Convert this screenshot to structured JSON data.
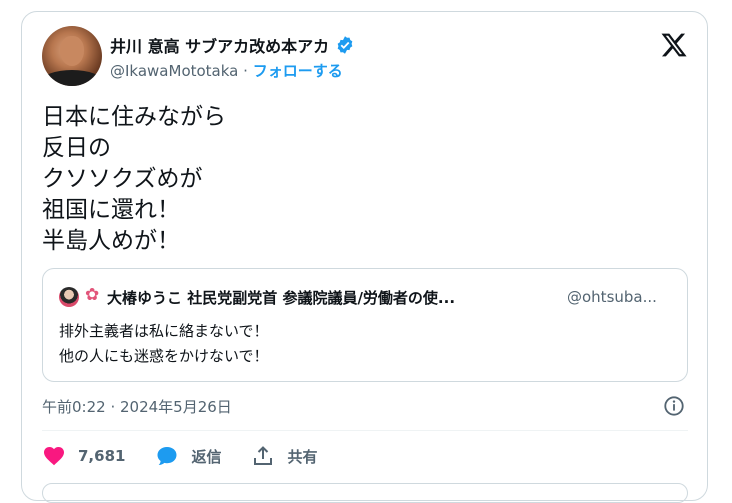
{
  "tweet": {
    "display_name": "井川 意高 サブアカ改め本アカ",
    "handle": "@IkawaMototaka",
    "separator": "·",
    "follow_label": "フォローする",
    "lines": [
      "日本に住みながら",
      "反日の",
      "クソソクズめが",
      "祖国に還れ！",
      "半島人めが！"
    ],
    "timestamp": "午前0:22 · 2024年5月26日"
  },
  "quote": {
    "display_name": "大椿ゆうこ 社民党副党首 参議院議員/労働者の使...",
    "handle": "@ohtsuba...",
    "lines": [
      "排外主義者は私に絡まないで！",
      "他の人にも迷惑をかけないで！"
    ]
  },
  "actions": {
    "like_count": "7,681",
    "reply_label": "返信",
    "share_label": "共有"
  },
  "colors": {
    "accent": "#1d9bf0",
    "like": "#f91880",
    "muted": "#536471"
  },
  "icons": [
    "avatar",
    "verified-badge-icon",
    "x-logo-icon",
    "flower-icon",
    "info-icon",
    "heart-icon",
    "reply-bubble-icon",
    "share-icon"
  ]
}
